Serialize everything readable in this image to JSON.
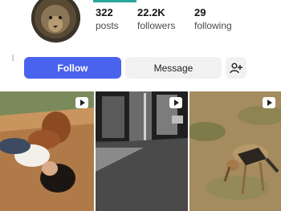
{
  "profile": {
    "stats": [
      {
        "value": "322",
        "label": "posts"
      },
      {
        "value": "22.2K",
        "label": "followers"
      },
      {
        "value": "29",
        "label": "following"
      }
    ]
  },
  "actions": {
    "follow_label": "Follow",
    "message_label": "Message",
    "add_friend_icon": "add-user-icon"
  },
  "videos": [
    {
      "icon": "play-icon"
    },
    {
      "icon": "play-icon"
    },
    {
      "icon": "play-icon"
    }
  ],
  "colors": {
    "accent": "#4a63ee",
    "tab_indicator": "#2aa69b",
    "secondary_button": "#f1f1f2"
  }
}
